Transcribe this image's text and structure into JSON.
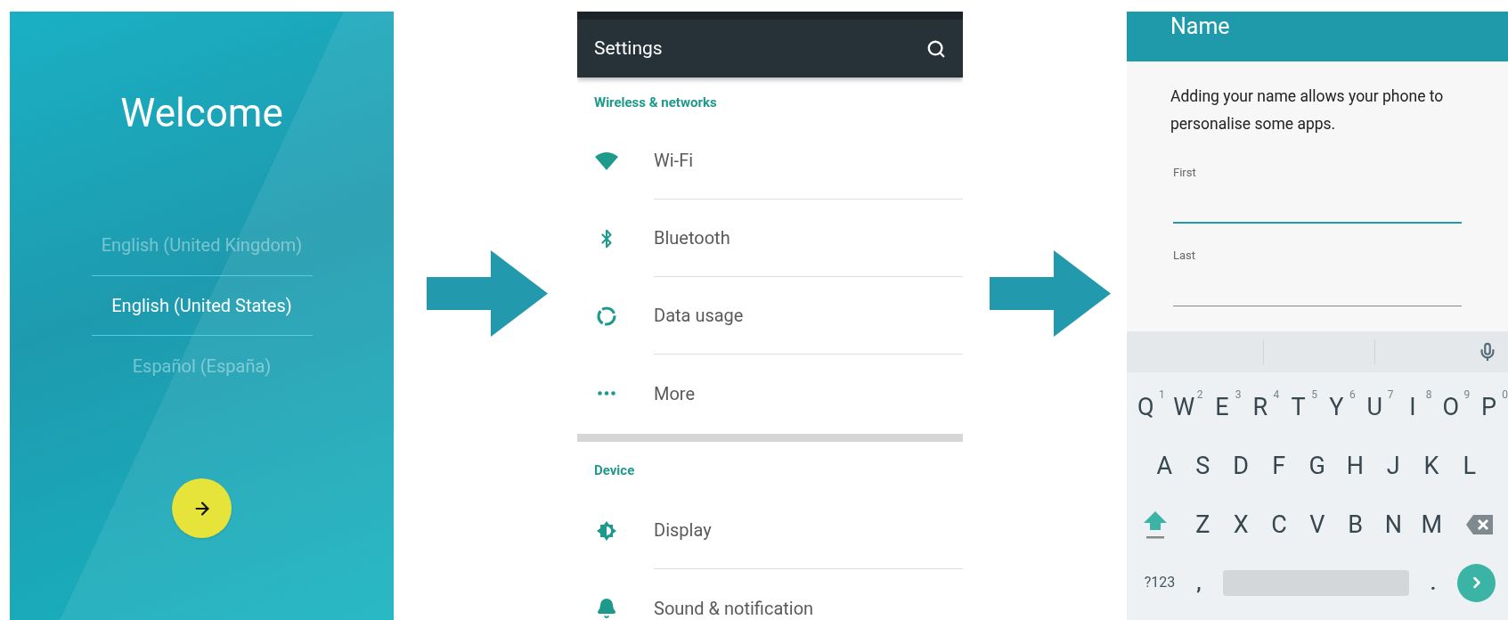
{
  "welcome_screen": {
    "title": "Welcome",
    "languages": [
      {
        "label": "English (United Kingdom)",
        "selected": false
      },
      {
        "label": "English (United States)",
        "selected": true
      },
      {
        "label": "Español (España)",
        "selected": false
      }
    ]
  },
  "settings_screen": {
    "title": "Settings",
    "sections": [
      {
        "header": "Wireless & networks",
        "items": [
          {
            "label": "Wi-Fi",
            "kind": "wifi"
          },
          {
            "label": "Bluetooth",
            "kind": "bluetooth"
          },
          {
            "label": "Data usage",
            "kind": "data"
          },
          {
            "label": "More",
            "kind": "more"
          }
        ]
      },
      {
        "header": "Device",
        "items": [
          {
            "label": "Display",
            "kind": "display"
          },
          {
            "label": "Sound & notification",
            "kind": "sound"
          }
        ]
      }
    ]
  },
  "name_screen": {
    "title": "Name",
    "description": "Adding your name allows your phone to personalise some apps.",
    "fields": [
      {
        "label": "First",
        "focused": true
      },
      {
        "label": "Last",
        "focused": false
      }
    ],
    "keyboard": {
      "letter_rows": [
        [
          {
            "label": "Q",
            "hint": "1"
          },
          {
            "label": "W",
            "hint": "2"
          },
          {
            "label": "E",
            "hint": "3"
          },
          {
            "label": "R",
            "hint": "4"
          },
          {
            "label": "T",
            "hint": "5"
          },
          {
            "label": "Y",
            "hint": "6"
          },
          {
            "label": "U",
            "hint": "7"
          },
          {
            "label": "I",
            "hint": "8"
          },
          {
            "label": "O",
            "hint": "9"
          },
          {
            "label": "P",
            "hint": "0"
          }
        ],
        [
          {
            "label": "A"
          },
          {
            "label": "S"
          },
          {
            "label": "D"
          },
          {
            "label": "F"
          },
          {
            "label": "G"
          },
          {
            "label": "H"
          },
          {
            "label": "J"
          },
          {
            "label": "K"
          },
          {
            "label": "L"
          }
        ],
        [
          {
            "label": "Z"
          },
          {
            "label": "X"
          },
          {
            "label": "C"
          },
          {
            "label": "V"
          },
          {
            "label": "B"
          },
          {
            "label": "N"
          },
          {
            "label": "M"
          }
        ]
      ],
      "symbols_key": "?123",
      "comma_key": ",",
      "period_key": "."
    }
  }
}
